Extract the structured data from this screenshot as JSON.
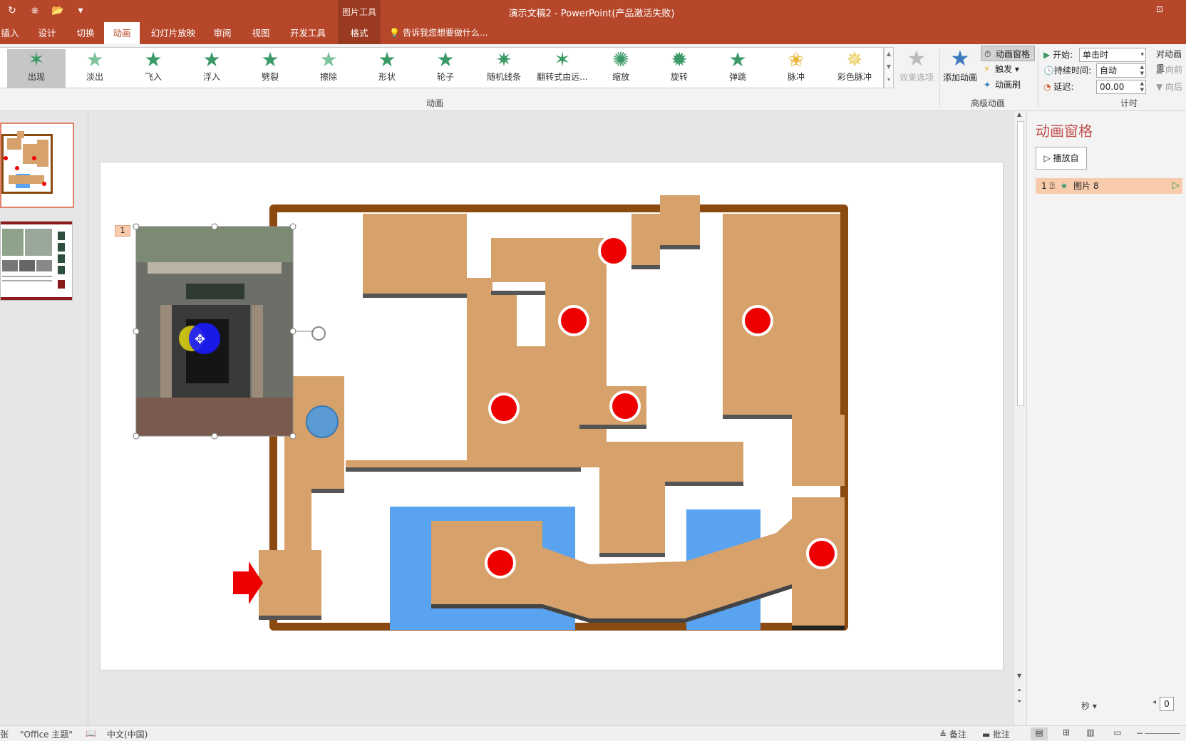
{
  "title_bar": {
    "qat": [
      "↻",
      "⎈",
      "📂",
      "▾"
    ],
    "context_group": "图片工具",
    "document_title": "演示文稿2 - PowerPoint(产品激活失败)",
    "window_button": "⊡"
  },
  "tabs": [
    {
      "label": "插入"
    },
    {
      "label": "设计"
    },
    {
      "label": "切换"
    },
    {
      "label": "动画",
      "active": true
    },
    {
      "label": "幻灯片放映"
    },
    {
      "label": "审阅"
    },
    {
      "label": "视图"
    },
    {
      "label": "开发工具"
    },
    {
      "label": "格式"
    }
  ],
  "tell_me": "告诉我您想要做什么...",
  "ribbon": {
    "animations": [
      {
        "label": "出现",
        "color": "#3c9a66",
        "selected": true
      },
      {
        "label": "淡出",
        "color": "#7cc39a"
      },
      {
        "label": "飞入",
        "color": "#3c9a66"
      },
      {
        "label": "浮入",
        "color": "#3c9a66"
      },
      {
        "label": "劈裂",
        "color": "#3c9a66"
      },
      {
        "label": "擦除",
        "color": "#7cc39a"
      },
      {
        "label": "形状",
        "color": "#3c9a66"
      },
      {
        "label": "轮子",
        "color": "#3c9a66"
      },
      {
        "label": "随机线条",
        "color": "#3c9a66"
      },
      {
        "label": "翻转式由远...",
        "color": "#3c9a66"
      },
      {
        "label": "缩放",
        "color": "#3c9a66"
      },
      {
        "label": "旋转",
        "color": "#3c9a66"
      },
      {
        "label": "弹跳",
        "color": "#3c9a66"
      },
      {
        "label": "脉冲",
        "color": "#e8b63c"
      },
      {
        "label": "彩色脉冲",
        "color": "#e8c84a"
      }
    ],
    "group_animation": "动画",
    "effect_options": "效果选项",
    "add_animation": "添加动画",
    "animation_pane_btn": "动画窗格",
    "trigger": "触发",
    "animation_painter": "动画刷",
    "group_advanced": "高级动画",
    "timing": {
      "start_label": "开始:",
      "start_value": "单击时",
      "duration_label": "持续时间:",
      "duration_value": "自动",
      "delay_label": "延迟:",
      "delay_value": "00.00",
      "group_label": "计时"
    },
    "reorder": {
      "title": "对动画重",
      "earlier": "向前",
      "later": "向后"
    }
  },
  "slide": {
    "animation_tag": "1",
    "accent_colors": {
      "maze_wall": "#8b4a10",
      "maze_room": "#d6a16a",
      "water": "#5aa3f0",
      "dot": "#ee0000",
      "start_arrow": "#ee0000",
      "player": "#5b9bd5"
    }
  },
  "anim_pane": {
    "title": "动画窗格",
    "play_button": "播放自",
    "item": {
      "index": "1",
      "name": "图片 8"
    },
    "seconds_label": "秒",
    "zoom_value": "0"
  },
  "status": {
    "slide_count": "张",
    "theme": "\"Office 主题\"",
    "language": "中文(中国)",
    "notes": "备注",
    "comments": "批注"
  }
}
